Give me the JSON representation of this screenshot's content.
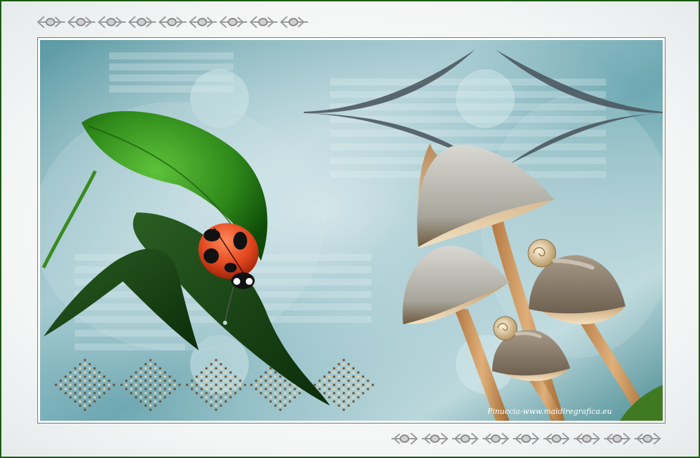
{
  "watermark": "Pinuccia-www.maidiregrafica.eu",
  "colors": {
    "outer_border": "#1c5a14",
    "background_teal": "#6aa8b0",
    "leaf_green": "#2f8a1a",
    "ladybug_red": "#e2461e",
    "mushroom_cap": "#b8b6ac"
  },
  "decorations": [
    "arrow-border-top",
    "arrow-border-bottom",
    "diamond-dot-pattern"
  ]
}
